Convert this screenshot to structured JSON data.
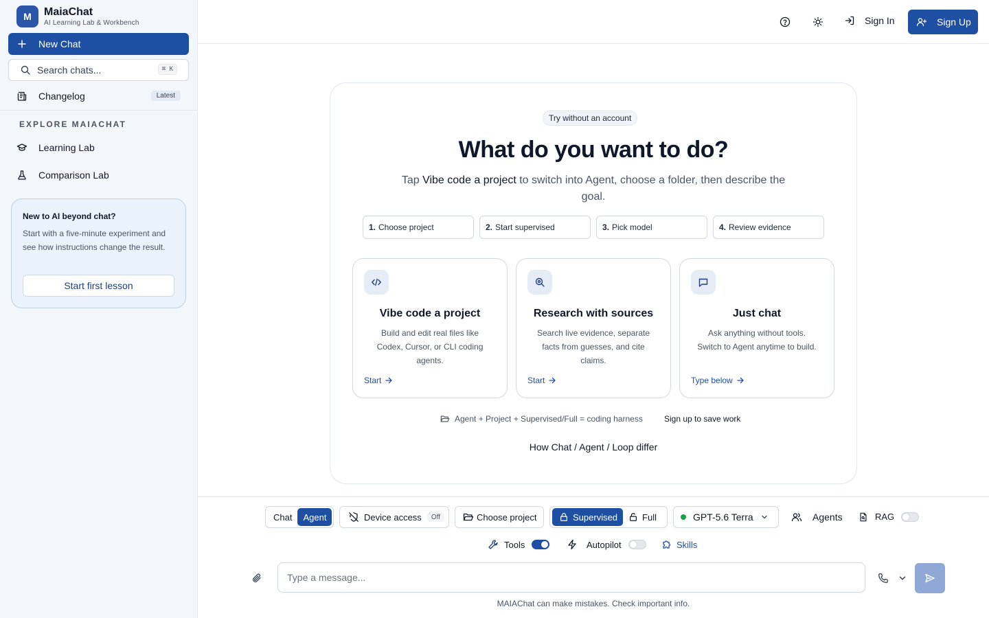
{
  "app": {
    "logo_letter": "M",
    "name": "MaiaChat",
    "tagline": "AI Learning Lab & Workbench"
  },
  "sidebar": {
    "new_chat_label": "New Chat",
    "search_placeholder": "Search chats...",
    "search_shortcut": "⌘ K",
    "changelog_label": "Changelog",
    "changelog_badge": "Latest",
    "section_title": "EXPLORE MAIACHAT",
    "items": [
      {
        "label": "Learning Lab",
        "icon": "graduation-cap-icon"
      },
      {
        "label": "Comparison Lab",
        "icon": "flask-icon"
      }
    ],
    "promo": {
      "title": "New to AI beyond chat?",
      "text": "Start with a five-minute experiment and see how instructions change the result.",
      "button": "Start first lesson"
    }
  },
  "header": {
    "sign_in": "Sign In",
    "sign_up": "Sign Up"
  },
  "hero": {
    "pill": "Try without an account",
    "title": "What do you want to do?",
    "subtitle_prefix": "Tap ",
    "subtitle_strong": "Vibe code a project",
    "subtitle_suffix": " to switch into Agent, choose a folder, then describe the goal.",
    "steps": [
      {
        "num": "1.",
        "label": "Choose project"
      },
      {
        "num": "2.",
        "label": "Start supervised"
      },
      {
        "num": "3.",
        "label": "Pick model"
      },
      {
        "num": "4.",
        "label": "Review evidence"
      }
    ],
    "cards": [
      {
        "icon": "code-icon",
        "title": "Vibe code a project",
        "desc": "Build and edit real files like Codex, Cursor, or CLI coding agents.",
        "link": "Start"
      },
      {
        "icon": "search-icon",
        "title": "Research with sources",
        "desc": "Search live evidence, separate facts from guesses, and cite claims.",
        "link": "Start"
      },
      {
        "icon": "message-icon",
        "title": "Just chat",
        "desc": "Ask anything without tools. Switch to Agent anytime to build.",
        "link": "Type below"
      }
    ],
    "harness_text": "Agent + Project + Supervised/Full = coding harness",
    "save_work": "Sign up to save work",
    "differ_link": "How Chat / Agent / Loop differ"
  },
  "composer": {
    "mode_chat": "Chat",
    "mode_agent": "Agent",
    "device_access": "Device access",
    "device_access_state": "Off",
    "choose_project": "Choose project",
    "supervised": "Supervised",
    "full": "Full",
    "model": "GPT-5.6 Terra",
    "agents": "Agents",
    "rag": "RAG",
    "rag_enabled": false,
    "tools": "Tools",
    "tools_enabled": true,
    "autopilot": "Autopilot",
    "autopilot_enabled": false,
    "skills": "Skills",
    "placeholder": "Type a message...",
    "disclaimer": "MAIAChat can make mistakes. Check important info."
  },
  "colors": {
    "primary": "#1f4fa3",
    "sidebar_bg": "#f3f6fa",
    "promo_bg": "#eaf2fc",
    "online_dot": "#16a34a"
  }
}
